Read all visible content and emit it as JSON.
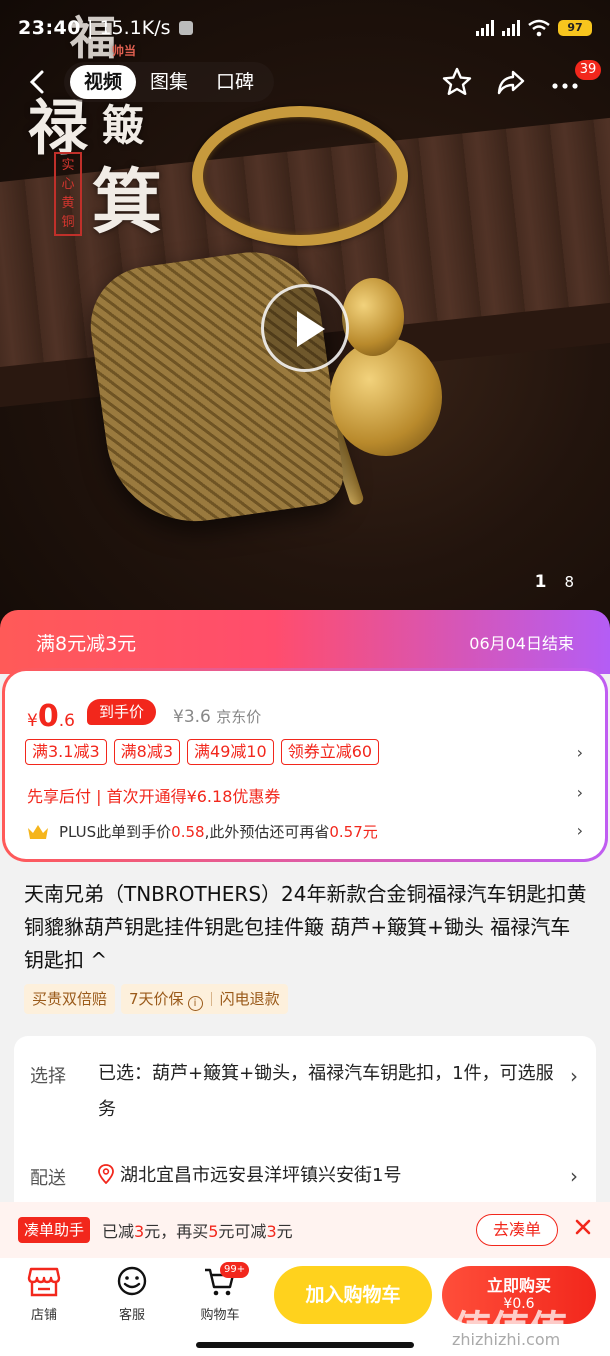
{
  "status_bar": {
    "time": "23:40",
    "speed": "15.1K/s",
    "battery": "97"
  },
  "nav": {
    "tabs": [
      {
        "label": "视频"
      },
      {
        "label": "图集"
      },
      {
        "label": "口碑"
      }
    ],
    "message_badge": "39"
  },
  "hero": {
    "overlay_text": {
      "fu": "福",
      "lu": "禄",
      "bo": "簸",
      "ji": "箕",
      "seal": "实心黄铜",
      "corner": "帅当"
    },
    "page_current": "1",
    "page_total": "8"
  },
  "promo": {
    "label": "满8元减3元",
    "end_date": "06月04日结束"
  },
  "price": {
    "currency": "¥",
    "integer": "0",
    "decimal": ".6",
    "tag": "到手价",
    "original": "¥3.6",
    "original_label": "京东价",
    "coupons": [
      "满3.1减3",
      "满8减3",
      "满49减10",
      "领券立减60"
    ],
    "pay_later": "先享后付 | 首次开通得¥6.18优惠券",
    "plus_prefix": "PLUS此单到手价",
    "plus_price": "0.58",
    "plus_middle": ",此外预估还可再省",
    "plus_save": "0.57元"
  },
  "product": {
    "title": "天南兄弟（TNBROTHERS）24年新款合金铜福禄汽车钥匙扣黄铜貔貅葫芦钥匙挂件钥匙包挂件簸 葫芦+簸箕+锄头 福禄汽车钥匙扣 ^",
    "guarantees": {
      "g1": "买贵双倍赔",
      "g2": "7天价保",
      "g3": "闪电退款"
    }
  },
  "options": {
    "select_label": "选择",
    "select_value": "已选：葫芦+簸箕+锄头，福禄汽车钥匙扣，1件，可选服务",
    "delivery_label": "配送",
    "delivery_value": "湖北宜昌市远安县洋坪镇兴安街1号"
  },
  "helper": {
    "tag": "凑单助手",
    "t1": "已减",
    "v1": "3",
    "t2": "元，再买",
    "v2": "5",
    "t3": "元可减",
    "v3": "3",
    "t4": "元",
    "button": "去凑单"
  },
  "bottom": {
    "store": "店铺",
    "service": "客服",
    "cart": "购物车",
    "cart_badge": "99+",
    "add_cart": "加入购物车",
    "buy_now": "立即购买",
    "buy_price": "¥0.6"
  },
  "watermark": {
    "logo": "值值值",
    "url": "zhizhizhi.com"
  }
}
